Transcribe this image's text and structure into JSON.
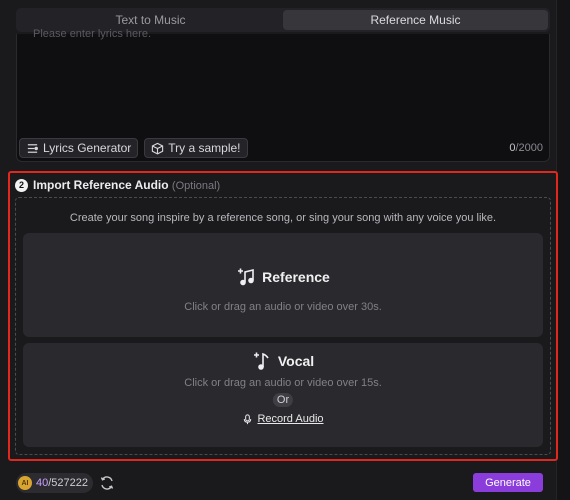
{
  "tabs": [
    {
      "label": "Text to Music",
      "active": false
    },
    {
      "label": "Reference Music",
      "active": true
    }
  ],
  "lyrics": {
    "placeholder": "Please enter lyrics here.",
    "lyrics_generator_label": "Lyrics Generator",
    "try_sample_label": "Try a sample!",
    "char_count_current": "0",
    "char_count_max": "/2000"
  },
  "reference_section": {
    "step_number": "2",
    "title": "Import Reference Audio",
    "optional": "(Optional)",
    "hint": "Create your song inspire by a reference song, or sing your song with any voice you like.",
    "reference_card": {
      "title": "Reference",
      "subtitle": "Click or drag an audio or video over 30s."
    },
    "vocal_card": {
      "title": "Vocal",
      "subtitle": "Click or drag an audio or video over 15s.",
      "or_label": "Or",
      "record_label": "Record Audio"
    }
  },
  "footer": {
    "coin_label": "AI",
    "credits_used": "40",
    "credits_total": "/527222",
    "generate_label": "Generate"
  },
  "colors": {
    "accent_purple": "#8a3ddb",
    "highlight_red": "#e0281f",
    "background": "#1a1a1d"
  }
}
